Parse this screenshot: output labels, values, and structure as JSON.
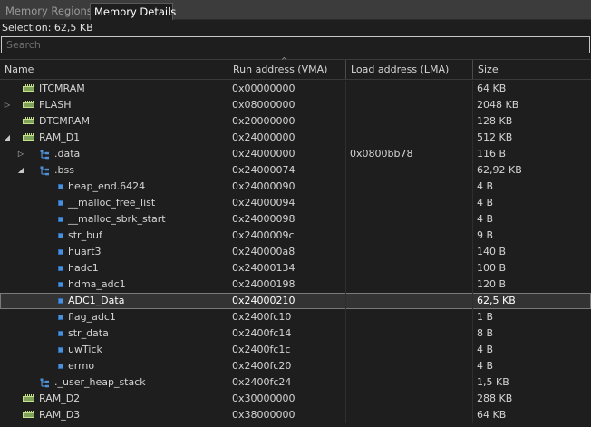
{
  "tabs": [
    {
      "label": "Memory Regions",
      "active": false
    },
    {
      "label": "Memory Details",
      "active": true
    }
  ],
  "selection_label": "Selection: 62,5 KB",
  "search": {
    "placeholder": "Search",
    "value": ""
  },
  "columns": {
    "name": "Name",
    "run_address": "Run address (VMA)",
    "load_address": "Load address (LMA)",
    "size": "Size"
  },
  "rows": [
    {
      "name": "ITCMRAM",
      "run": "0x00000000",
      "load": "",
      "size": "64 KB",
      "icon": "memory-chip-icon",
      "level": 0,
      "expander": "none",
      "selected": false
    },
    {
      "name": "FLASH",
      "run": "0x08000000",
      "load": "",
      "size": "2048 KB",
      "icon": "memory-chip-icon",
      "level": 0,
      "expander": "collapsed",
      "selected": false
    },
    {
      "name": "DTCMRAM",
      "run": "0x20000000",
      "load": "",
      "size": "128 KB",
      "icon": "memory-chip-icon",
      "level": 0,
      "expander": "none",
      "selected": false
    },
    {
      "name": "RAM_D1",
      "run": "0x24000000",
      "load": "",
      "size": "512 KB",
      "icon": "memory-chip-icon",
      "level": 0,
      "expander": "expanded",
      "selected": false
    },
    {
      "name": ".data",
      "run": "0x24000000",
      "load": "0x0800bb78",
      "size": "116 B",
      "icon": "section-tree-icon",
      "level": 1,
      "expander": "collapsed",
      "selected": false
    },
    {
      "name": ".bss",
      "run": "0x24000074",
      "load": "",
      "size": "62,92 KB",
      "icon": "section-tree-icon",
      "level": 1,
      "expander": "expanded",
      "selected": false
    },
    {
      "name": "heap_end.6424",
      "run": "0x24000090",
      "load": "",
      "size": "4 B",
      "icon": "symbol-icon",
      "level": 2,
      "expander": "none",
      "selected": false
    },
    {
      "name": "__malloc_free_list",
      "run": "0x24000094",
      "load": "",
      "size": "4 B",
      "icon": "symbol-icon",
      "level": 2,
      "expander": "none",
      "selected": false
    },
    {
      "name": "__malloc_sbrk_start",
      "run": "0x24000098",
      "load": "",
      "size": "4 B",
      "icon": "symbol-icon",
      "level": 2,
      "expander": "none",
      "selected": false
    },
    {
      "name": "str_buf",
      "run": "0x2400009c",
      "load": "",
      "size": "9 B",
      "icon": "symbol-icon",
      "level": 2,
      "expander": "none",
      "selected": false
    },
    {
      "name": "huart3",
      "run": "0x240000a8",
      "load": "",
      "size": "140 B",
      "icon": "symbol-icon",
      "level": 2,
      "expander": "none",
      "selected": false
    },
    {
      "name": "hadc1",
      "run": "0x24000134",
      "load": "",
      "size": "100 B",
      "icon": "symbol-icon",
      "level": 2,
      "expander": "none",
      "selected": false
    },
    {
      "name": "hdma_adc1",
      "run": "0x24000198",
      "load": "",
      "size": "120 B",
      "icon": "symbol-icon",
      "level": 2,
      "expander": "none",
      "selected": false
    },
    {
      "name": "ADC1_Data",
      "run": "0x24000210",
      "load": "",
      "size": "62,5 KB",
      "icon": "symbol-icon",
      "level": 2,
      "expander": "none",
      "selected": true
    },
    {
      "name": "flag_adc1",
      "run": "0x2400fc10",
      "load": "",
      "size": "1 B",
      "icon": "symbol-icon",
      "level": 2,
      "expander": "none",
      "selected": false
    },
    {
      "name": "str_data",
      "run": "0x2400fc14",
      "load": "",
      "size": "8 B",
      "icon": "symbol-icon",
      "level": 2,
      "expander": "none",
      "selected": false
    },
    {
      "name": "uwTick",
      "run": "0x2400fc1c",
      "load": "",
      "size": "4 B",
      "icon": "symbol-icon",
      "level": 2,
      "expander": "none",
      "selected": false
    },
    {
      "name": "errno",
      "run": "0x2400fc20",
      "load": "",
      "size": "4 B",
      "icon": "symbol-icon",
      "level": 2,
      "expander": "none",
      "selected": false
    },
    {
      "name": "._user_heap_stack",
      "run": "0x2400fc24",
      "load": "",
      "size": "1,5 KB",
      "icon": "section-tree-icon",
      "level": 1,
      "expander": "none",
      "selected": false
    },
    {
      "name": "RAM_D2",
      "run": "0x30000000",
      "load": "",
      "size": "288 KB",
      "icon": "memory-chip-icon",
      "level": 0,
      "expander": "none",
      "selected": false
    },
    {
      "name": "RAM_D3",
      "run": "0x38000000",
      "load": "",
      "size": "64 KB",
      "icon": "memory-chip-icon",
      "level": 0,
      "expander": "none",
      "selected": false
    }
  ]
}
